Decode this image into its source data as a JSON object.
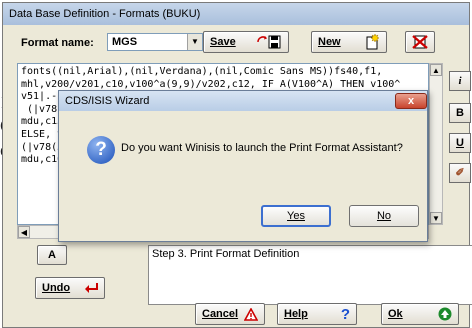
{
  "window": {
    "title": "Data Base Definition - Formats (BUKU)"
  },
  "format": {
    "label": "Format name:",
    "value": "MGS",
    "save_label": "Save",
    "new_label": "New"
  },
  "code_lines": [
    "fonts((nil,Arial),(nil,Verdana),(nil,Comic Sans MS))fs40,f1,",
    "mhl,v200/v201,c10,v100^a(9,9)/v202,c12, IF A(V100^A) THEN v100^",
    "v51|.--",
    " (|v78",
    "mdu,c15",
    "ELSE, v",
    "(|v78(5",
    "mdu,c10("
  ],
  "side_buttons": [
    "i",
    "B",
    "U",
    "✐"
  ],
  "left_panel": {
    "a_label": "A",
    "undo_label": "Undo"
  },
  "step_text": "Step 3. Print Format Definition",
  "bottom": {
    "cancel_label": "Cancel",
    "help_label": "Help",
    "ok_label": "Ok"
  },
  "background_chars": [
    "1",
    "C",
    "e"
  ],
  "dialog": {
    "title": "CDS/ISIS Wizard",
    "close_glyph": "x",
    "message": "Do you want Winisis to launch the Print Format Assistant?",
    "yes_label": "Yes",
    "no_label": "No"
  }
}
